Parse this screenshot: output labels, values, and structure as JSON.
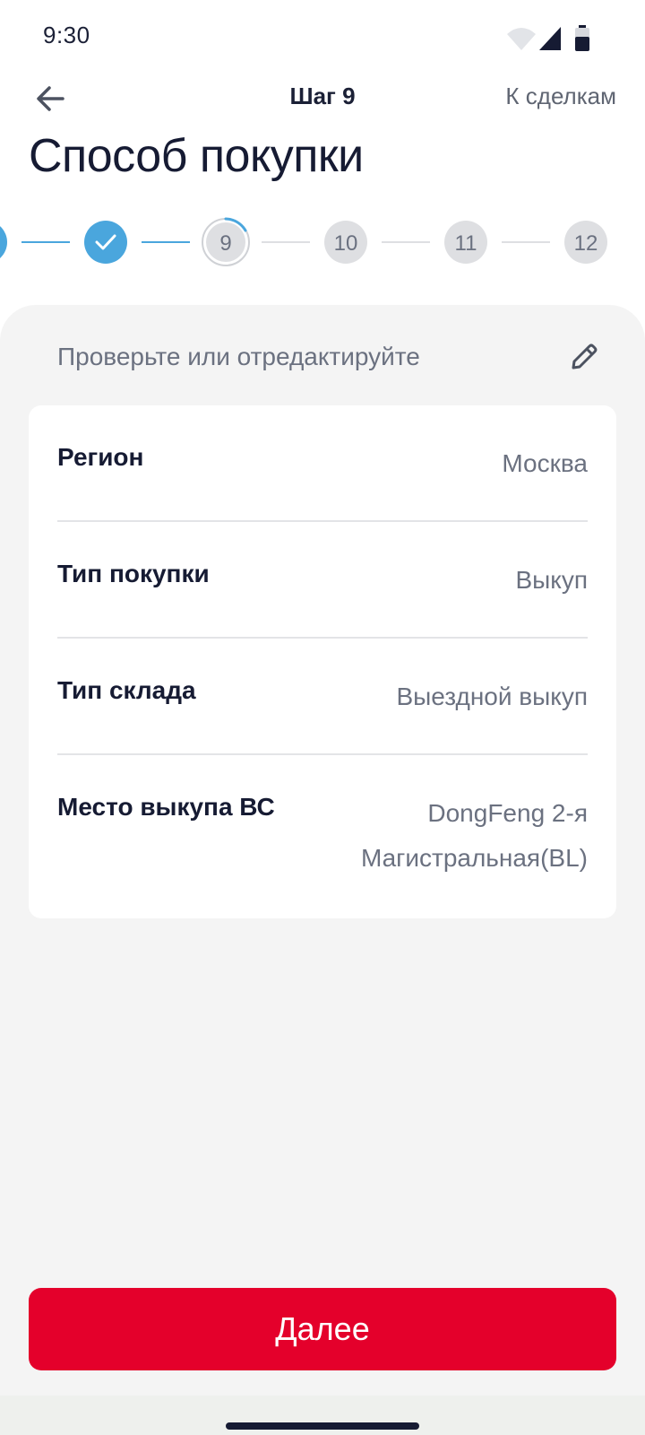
{
  "status_bar": {
    "time": "9:30",
    "icons": [
      "wifi-icon",
      "cellular-signal-icon",
      "battery-icon"
    ]
  },
  "header": {
    "back_icon": "arrow-left-icon",
    "step_title": "Шаг 9",
    "deals_link": "К сделкам"
  },
  "page": {
    "title": "Способ покупки"
  },
  "stepper": {
    "steps": [
      {
        "label": "",
        "state": "done"
      },
      {
        "label": "",
        "state": "done"
      },
      {
        "label": "9",
        "state": "current"
      },
      {
        "label": "10",
        "state": "pending"
      },
      {
        "label": "11",
        "state": "pending"
      },
      {
        "label": "12",
        "state": "pending"
      }
    ],
    "current_step_progress": 0.15
  },
  "card": {
    "hint": "Проверьте или отредактируйте",
    "edit_icon": "pencil-icon"
  },
  "details": [
    {
      "label": "Регион",
      "value": "Москва"
    },
    {
      "label": "Тип покупки",
      "value": "Выкуп"
    },
    {
      "label": "Тип склада",
      "value": "Выездной выкуп"
    },
    {
      "label": "Место выкупа ВС",
      "value": "DongFeng 2-я Магистральная(BL)"
    }
  ],
  "footer": {
    "next_label": "Далее"
  },
  "colors": {
    "accent_blue": "#4aa6dd",
    "primary_red": "#e4002b",
    "dark_text": "#161b33",
    "muted_text": "#6b7180",
    "card_bg": "#f4f4f4"
  }
}
